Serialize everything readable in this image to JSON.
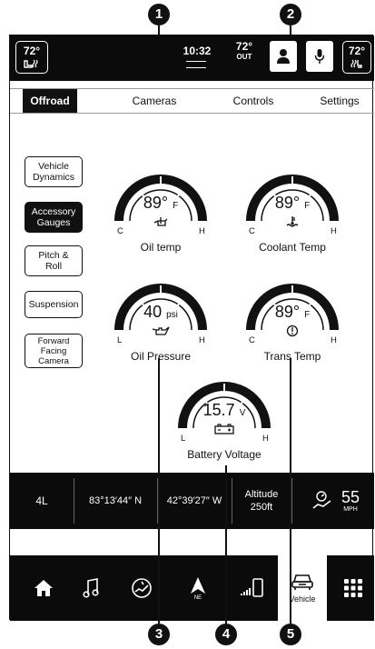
{
  "callouts": [
    "1",
    "2",
    "3",
    "4",
    "5"
  ],
  "topbar": {
    "left_temp": "72°",
    "time": "10:32",
    "out_temp": "72°",
    "out_label": "OUT",
    "right_temp": "72°"
  },
  "tabs": [
    "Offroad",
    "Cameras",
    "Controls",
    "Settings"
  ],
  "active_tab": "Offroad",
  "side_buttons": [
    {
      "label": "Vehicle Dynamics"
    },
    {
      "label": "Accessory Gauges"
    },
    {
      "label": "Pitch & Roll"
    },
    {
      "label": "Suspension"
    },
    {
      "label": "Forward Facing Camera"
    }
  ],
  "gauges": {
    "oil_temp": {
      "value": "89°",
      "unit": "F",
      "left": "C",
      "right": "H",
      "label": "Oil temp",
      "icon": "oil-temp-icon"
    },
    "coolant_temp": {
      "value": "89°",
      "unit": "F",
      "left": "C",
      "right": "H",
      "label": "Coolant Temp",
      "icon": "coolant-temp-icon"
    },
    "oil_pressure": {
      "value": "40",
      "unit": "psi",
      "left": "L",
      "right": "H",
      "label": "Oil Pressure",
      "icon": "oil-can-icon"
    },
    "trans_temp": {
      "value": "89°",
      "unit": "F",
      "left": "C",
      "right": "H",
      "label": "Trans Temp",
      "icon": "transmission-icon"
    },
    "battery_voltage": {
      "value": "15.7",
      "unit": "V",
      "left": "L",
      "right": "H",
      "label": "Battery Voltage",
      "icon": "battery-icon"
    }
  },
  "infobar": {
    "gear": "4L",
    "longitude": "83°13′44″ N",
    "latitude": "42°39′27″ W",
    "altitude_label": "Altitude",
    "altitude_value": "250ft",
    "speed": "55",
    "speed_unit": "MPH"
  },
  "navbar": {
    "nav_letters": "NE",
    "vehicle_label": "Vehicle"
  }
}
